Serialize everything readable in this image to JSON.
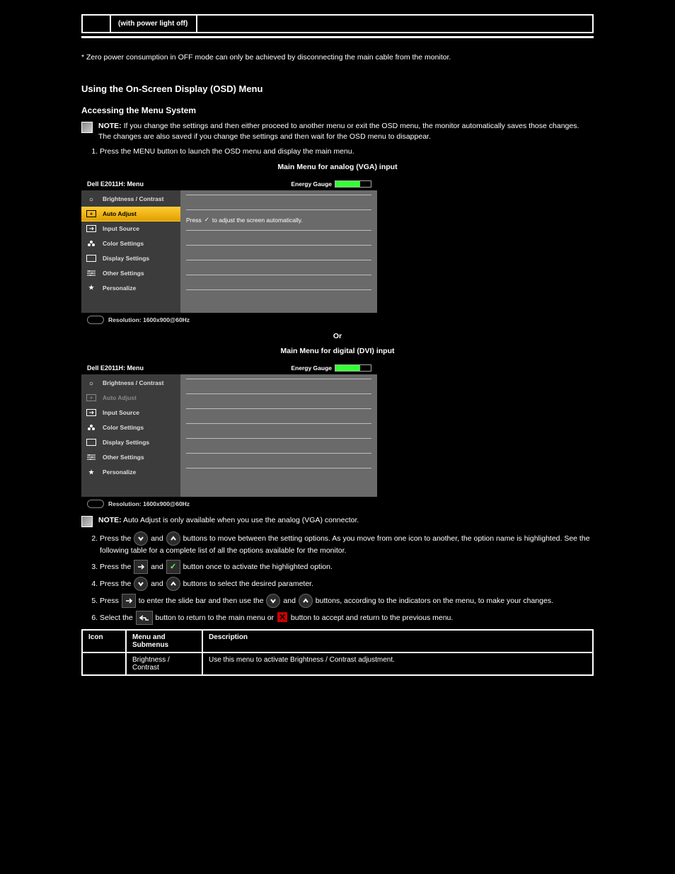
{
  "top_table": {
    "col1": "",
    "col2": "(with power light off)",
    "col3": ""
  },
  "pre_note": "* Zero power consumption in OFF mode can only be achieved by disconnecting the main cable from the monitor.",
  "section_title": "Using the On-Screen Display (OSD) Menu",
  "sub_title": "Accessing the Menu System",
  "note1_label": "NOTE:",
  "note1_text": "If you change the settings and then either proceed to another menu or exit the OSD menu, the monitor automatically saves those changes. The changes are also saved if you change the settings and then wait for the OSD menu to disappear.",
  "step1": "Press the MENU button to launch the OSD menu and display the main menu.",
  "analog_caption": "Main Menu for analog (VGA) input",
  "or_text": "Or",
  "digital_caption": "Main Menu for digital (DVI) input",
  "osd": {
    "title": "Dell E2011H: Menu",
    "energy_label": "Energy Gauge",
    "items": [
      {
        "icon": "brightness",
        "label": "Brightness / Contrast"
      },
      {
        "icon": "auto",
        "label": "Auto Adjust"
      },
      {
        "icon": "input",
        "label": "Input Source"
      },
      {
        "icon": "color",
        "label": "Color Settings"
      },
      {
        "icon": "display",
        "label": "Display Settings"
      },
      {
        "icon": "other",
        "label": "Other Settings"
      },
      {
        "icon": "star",
        "label": "Personalize"
      }
    ],
    "auto_msg_pre": "Press",
    "auto_msg_post": "to adjust the screen automatically.",
    "footer_label": "Resolution: 1600x900@60Hz"
  },
  "note2_label": "NOTE:",
  "note2_text": "Auto Adjust is only available when you use the analog (VGA) connector.",
  "step2a": "Press the",
  "step2b": "and",
  "step2c": "buttons to move between the setting options. As you move from one icon to another, the option name is highlighted. See the following table for a complete list of all the options available for the monitor.",
  "step3a": "Press the",
  "step3b": "and",
  "step3c": "button once to activate the highlighted option.",
  "step4a": "Press the",
  "step4b": "and",
  "step4c": "buttons to select the desired parameter.",
  "step5a": "Press",
  "step5b": "to enter the slide bar and then use the",
  "step5c": "and",
  "step5d": "buttons, according to the indicators on the menu, to make your changes.",
  "step6a": "Select the",
  "step6b": "button to return to the main menu or",
  "step6c": "button to accept and return to the previous menu.",
  "desc_headers": [
    "Icon",
    "Menu and Submenus",
    "Description"
  ],
  "desc_row1": {
    "menu": "Brightness / Contrast",
    "desc": "Use this menu to activate Brightness / Contrast adjustment."
  }
}
